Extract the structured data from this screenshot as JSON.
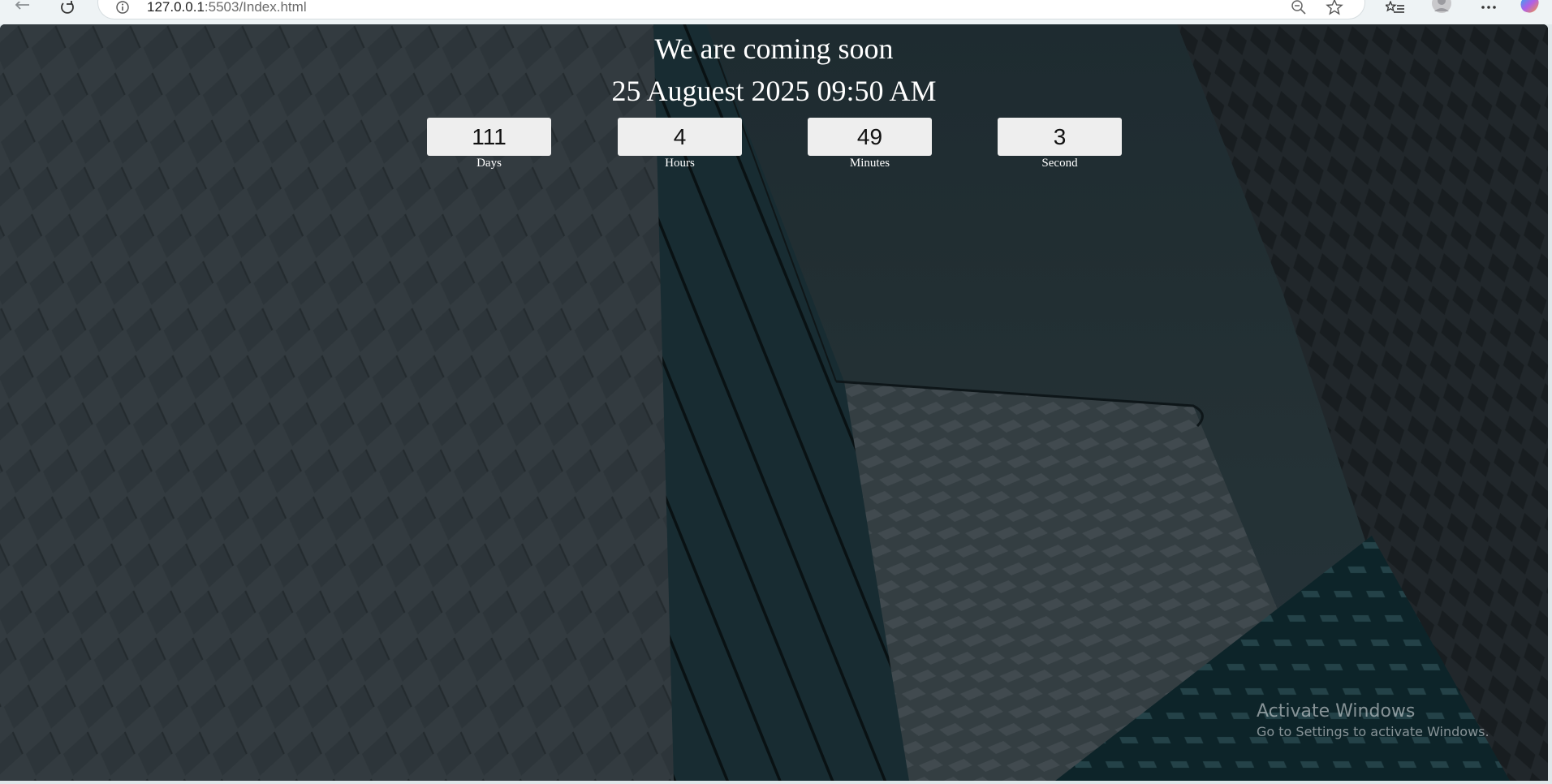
{
  "browser": {
    "url_host": "127.0.0.1",
    "url_rest": ":5503/Index.html",
    "icons": {
      "back": "back-arrow-icon",
      "reload": "reload-icon",
      "info": "info-icon",
      "zoom": "zoom-out-icon",
      "star": "favorite-star-icon",
      "favorites": "favorites-list-icon",
      "profile": "profile-avatar-icon",
      "more": "more-options-icon",
      "copilot": "copilot-icon"
    }
  },
  "page": {
    "title": "We are coming soon",
    "launch_date": "25 Auguest 2025 09:50 AM",
    "countdown": [
      {
        "value": "111",
        "label": "Days"
      },
      {
        "value": "4",
        "label": "Hours"
      },
      {
        "value": "49",
        "label": "Minutes"
      },
      {
        "value": "3",
        "label": "Second"
      }
    ]
  },
  "watermark": {
    "title": "Activate Windows",
    "subtitle": "Go to Settings to activate Windows."
  }
}
